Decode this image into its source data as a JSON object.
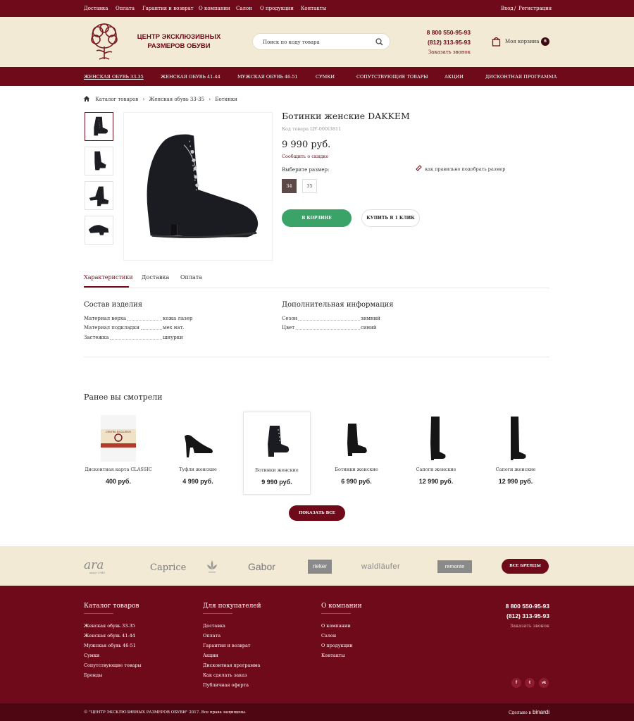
{
  "topbar": {
    "links": [
      "Доставка",
      "Оплата",
      "Гарантия и возврат",
      "О компании",
      "Салон",
      "О продукции",
      "Контакты"
    ],
    "login": "Вход",
    "separator": "/",
    "register": "Регистрация"
  },
  "header": {
    "logo_line1": "ЦЕНТР ЭКСКЛЮЗИВНЫХ",
    "logo_line2": "РАЗМЕРОВ ОБУВИ",
    "search_placeholder": "Поиск по коду товара",
    "phone1": "8 800 550-95-93",
    "phone2": "(812) 313-95-93",
    "callback": "Заказать звонок",
    "cart_label": "Моя корзина",
    "cart_count": "6"
  },
  "nav": {
    "items": [
      "ЖЕНСКАЯ ОБУВЬ 33-35",
      "ЖЕНСКАЯ ОБУВЬ 41-44",
      "МУЖСКАЯ ОБУВЬ 46-51",
      "СУМКИ",
      "СОПУТСТВУЮЩИЕ ТОВАРЫ",
      "АКЦИИ",
      "ДИСКОНТНАЯ ПРОГРАММА"
    ]
  },
  "breadcrumb": {
    "items": [
      "Каталог товаров",
      "Женская обувь 33-35",
      "Ботинки"
    ],
    "separator": "›"
  },
  "product": {
    "title": "Ботинки женские DAKKEM",
    "code": "Код товара ЦУ-000t3811",
    "price": "9 990 руб.",
    "discount_link": "Сообщить о скидке",
    "size_label": "Выберите размер:",
    "size_guide": "как правильно подобрать размер",
    "sizes": [
      "34",
      "35"
    ],
    "selected_size": "34",
    "btn_cart": "В КОРЗИНЕ",
    "btn_oneclick": "КУПИТЬ В 1 КЛИК"
  },
  "tabs": [
    "Характеристики",
    "Доставка",
    "Оплата"
  ],
  "composition": {
    "title": "Состав изделия",
    "rows": [
      {
        "k": "Материал верха",
        "v": "кожа лазер"
      },
      {
        "k": "Материал подкладки",
        "v": "мех нат."
      },
      {
        "k": "Застежка",
        "v": "шнурки"
      }
    ]
  },
  "extra": {
    "title": "Дополнительная информация",
    "rows": [
      {
        "k": "Сезон",
        "v": "зимний"
      },
      {
        "k": "Цвет",
        "v": "синий"
      }
    ]
  },
  "recent": {
    "title": "Ранее вы смотрели",
    "card_text": "CENTRE EXCLUSIVE",
    "items": [
      {
        "name": "Дисконтная карта CLASSIC",
        "price": "400 руб."
      },
      {
        "name": "Туфли женские",
        "price": "4 990 руб."
      },
      {
        "name": "Ботинки женские",
        "price": "9 990 руб."
      },
      {
        "name": "Ботинки женские",
        "price": "6 990 руб."
      },
      {
        "name": "Сапоги женские",
        "price": "12 990 руб."
      },
      {
        "name": "Сапоги женские",
        "price": "12 990 руб."
      }
    ],
    "btn_showall": "ПОКАЗАТЬ ВСЕ"
  },
  "brands": {
    "items": [
      "ara",
      "since 1949",
      "Caprice",
      "Gabor",
      "rieker",
      "waldläufer",
      "remonte"
    ],
    "btn_all": "ВСЕ БРЕНДЫ"
  },
  "footer": {
    "catalog_title": "Каталог товаров",
    "catalog_links": [
      "Женская обувь 33-35",
      "Женская обувь 41-44",
      "Мужская обувь 46-51",
      "Сумки",
      "Сопутствующие товары",
      "Бренды"
    ],
    "buyers_title": "Для покупателей",
    "buyers_links": [
      "Доставка",
      "Оплата",
      "Гарантия и возврат",
      "Акции",
      "Дисконтная программа",
      "Как сделать заказ",
      "Публичная оферта"
    ],
    "company_title": "О компании",
    "company_links": [
      "О компании",
      "Салон",
      "О продукции",
      "Контакты"
    ],
    "phone1": "8 800 550-95-93",
    "phone2": "(812) 313-95-93",
    "callback": "Заказать звонок",
    "social": [
      "f",
      "t",
      "vk"
    ],
    "copyright": "© \"ЦЕНТР ЭКСКЛЮЗИВНЫХ РАЗМЕРОВ ОБУВИ\" 2017. Все права защищены.",
    "made_by_prefix": "Сделано в",
    "made_by_brand": "binardi"
  },
  "colors": {
    "brand": "#6e0a19",
    "cream": "#f3ead6",
    "green": "#3aa368"
  }
}
